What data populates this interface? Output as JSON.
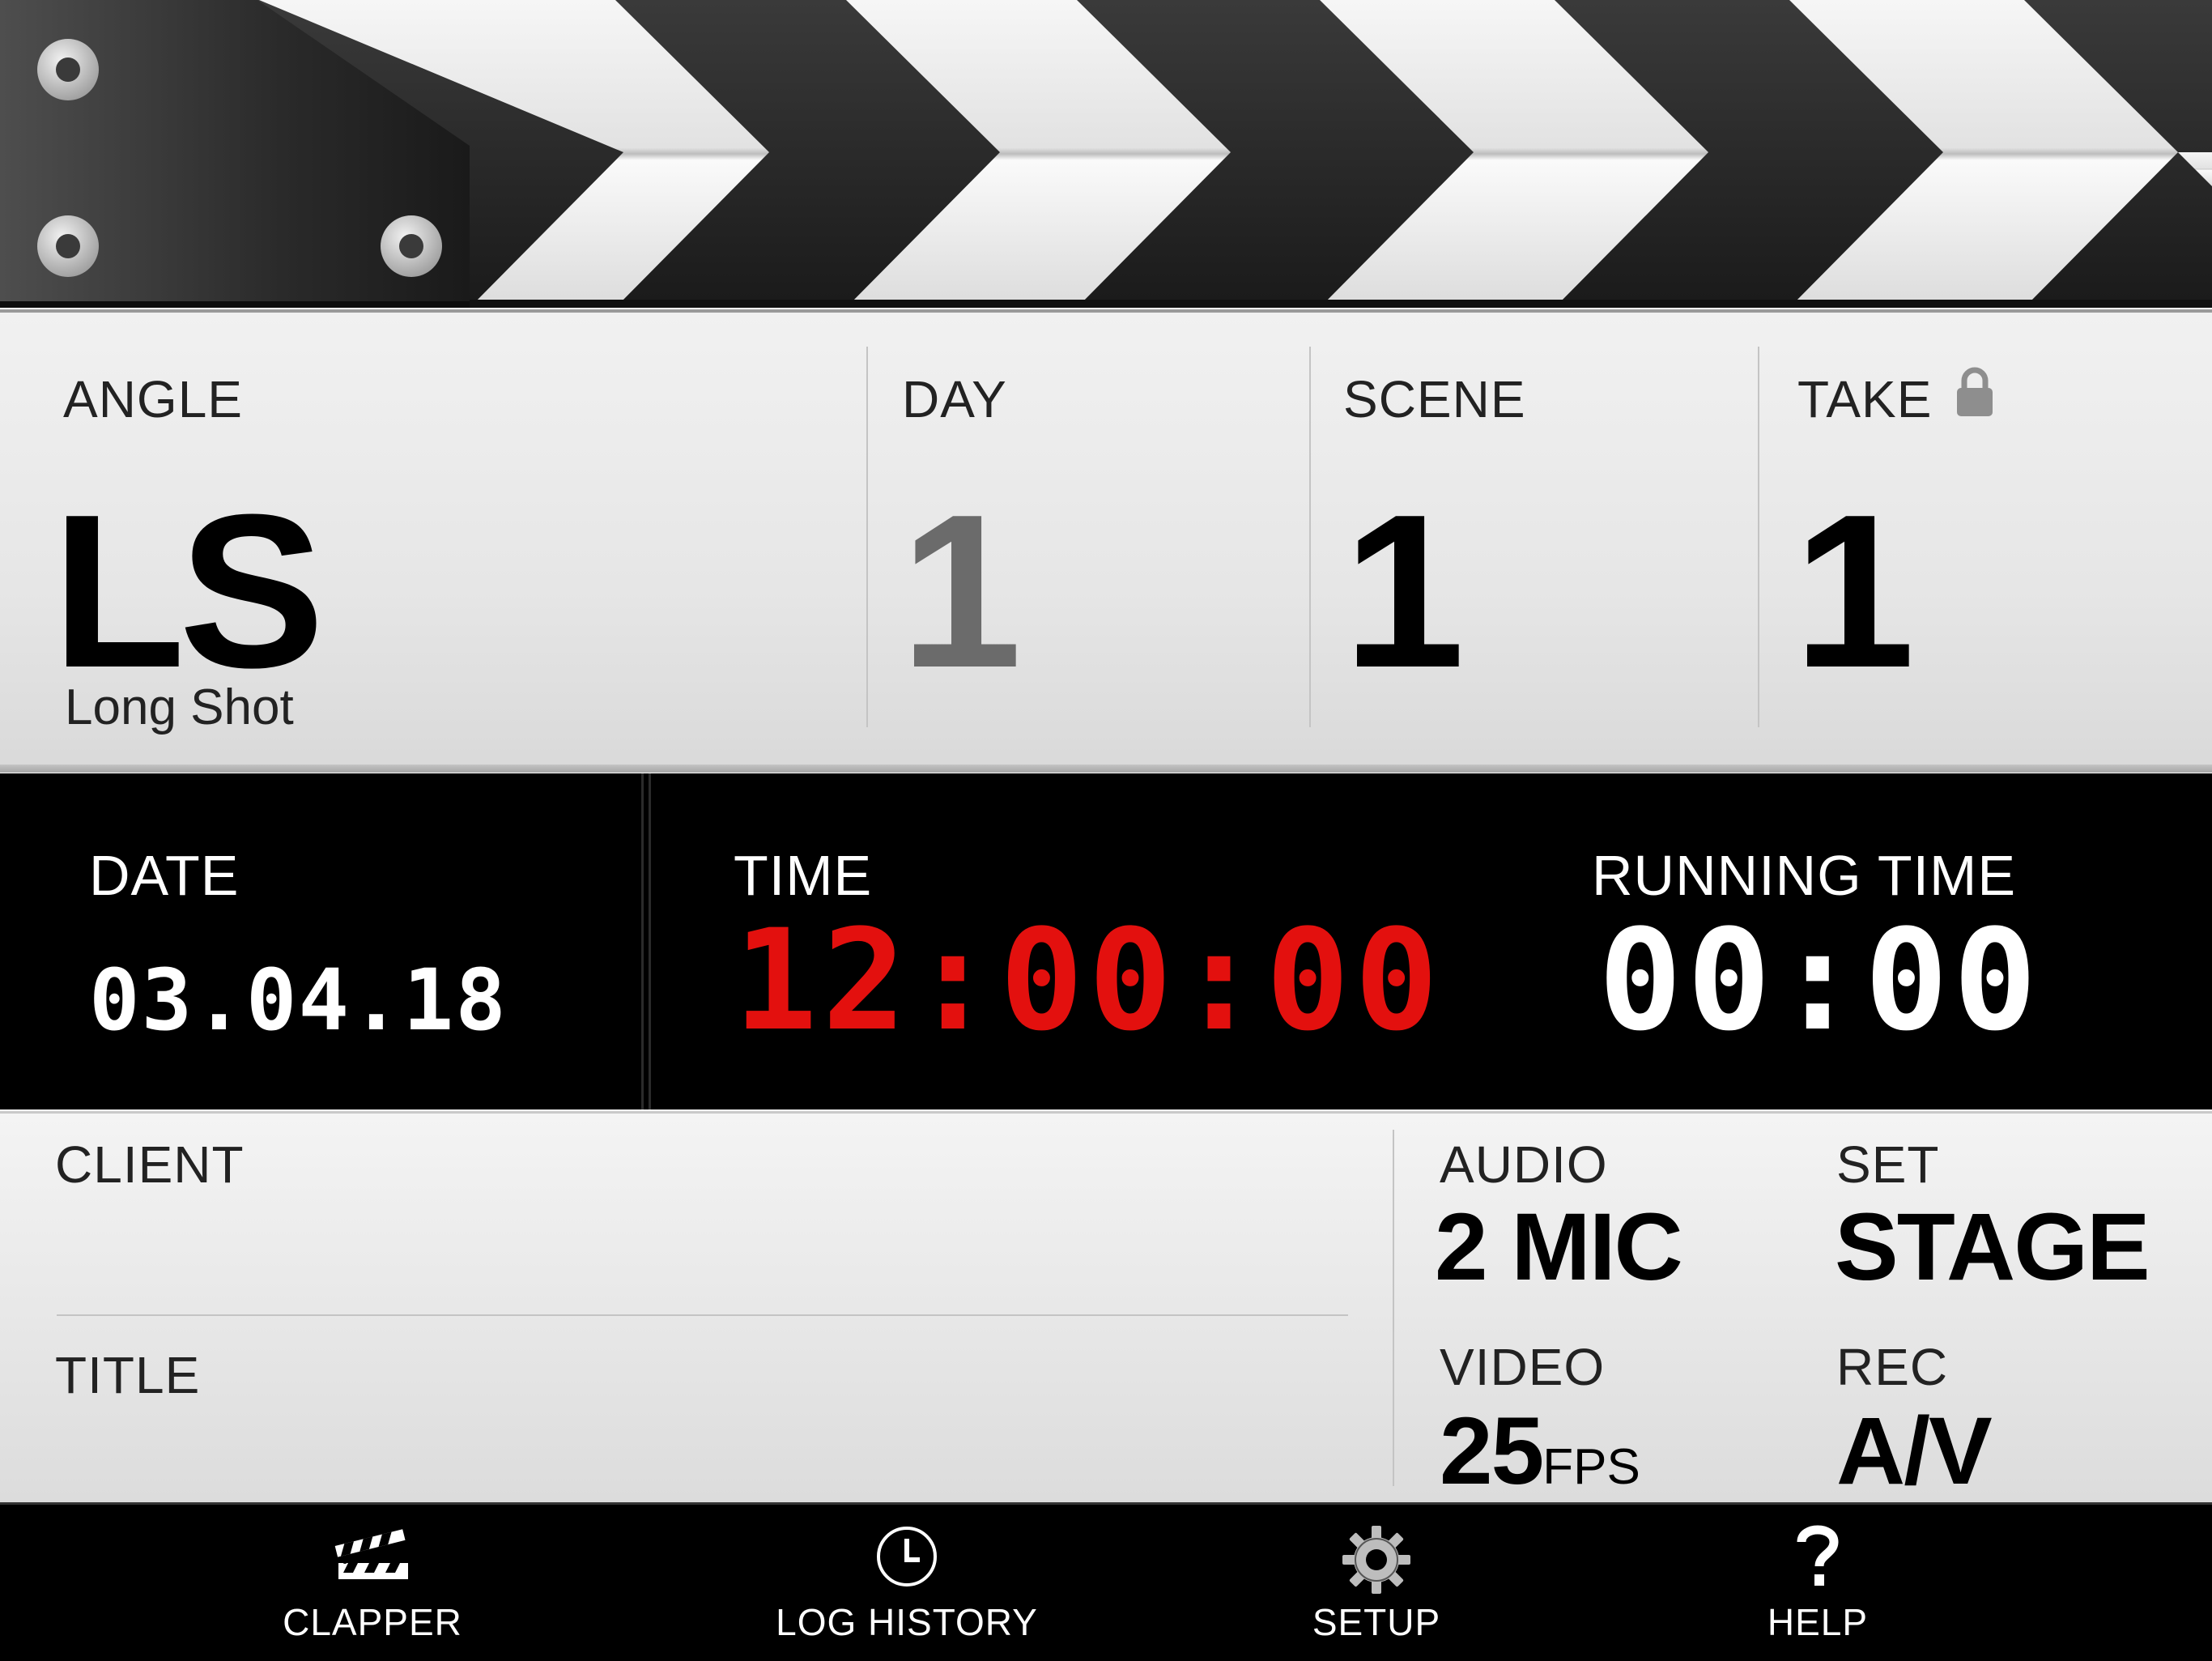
{
  "slate": {
    "angle": {
      "label": "ANGLE",
      "value": "LS",
      "description": "Long Shot"
    },
    "day": {
      "label": "DAY",
      "value": "1"
    },
    "scene": {
      "label": "SCENE",
      "value": "1"
    },
    "take": {
      "label": "TAKE",
      "value": "1",
      "lock_icon": "lock-icon"
    }
  },
  "clock": {
    "date": {
      "label": "DATE",
      "value": "03.04.18"
    },
    "time": {
      "label": "TIME",
      "value": "12:00:00",
      "color": "#e3100e"
    },
    "running_time": {
      "label": "RUNNING TIME",
      "value": "00:00",
      "color": "#ffffff"
    }
  },
  "production": {
    "client": {
      "label": "CLIENT",
      "value": ""
    },
    "title": {
      "label": "TITLE",
      "value": ""
    },
    "audio": {
      "label": "AUDIO",
      "value": "2 MIC"
    },
    "set": {
      "label": "SET",
      "value": "STAGE"
    },
    "video": {
      "label": "VIDEO",
      "value": "25",
      "unit": "FPS"
    },
    "rec": {
      "label": "REC",
      "value": "A/V"
    }
  },
  "tabs": [
    {
      "label": "CLAPPER",
      "icon": "clapperboard-icon"
    },
    {
      "label": "LOG HISTORY",
      "icon": "clock-icon"
    },
    {
      "label": "SETUP",
      "icon": "gear-icon"
    },
    {
      "label": "HELP",
      "icon": "question-mark-icon"
    }
  ],
  "colors": {
    "panel_black": "#000000",
    "panel_light": "#e6e6e6",
    "time_red": "#e3100e",
    "day_gray": "#6b6b6b",
    "lock_gray": "#8e8e8e"
  }
}
